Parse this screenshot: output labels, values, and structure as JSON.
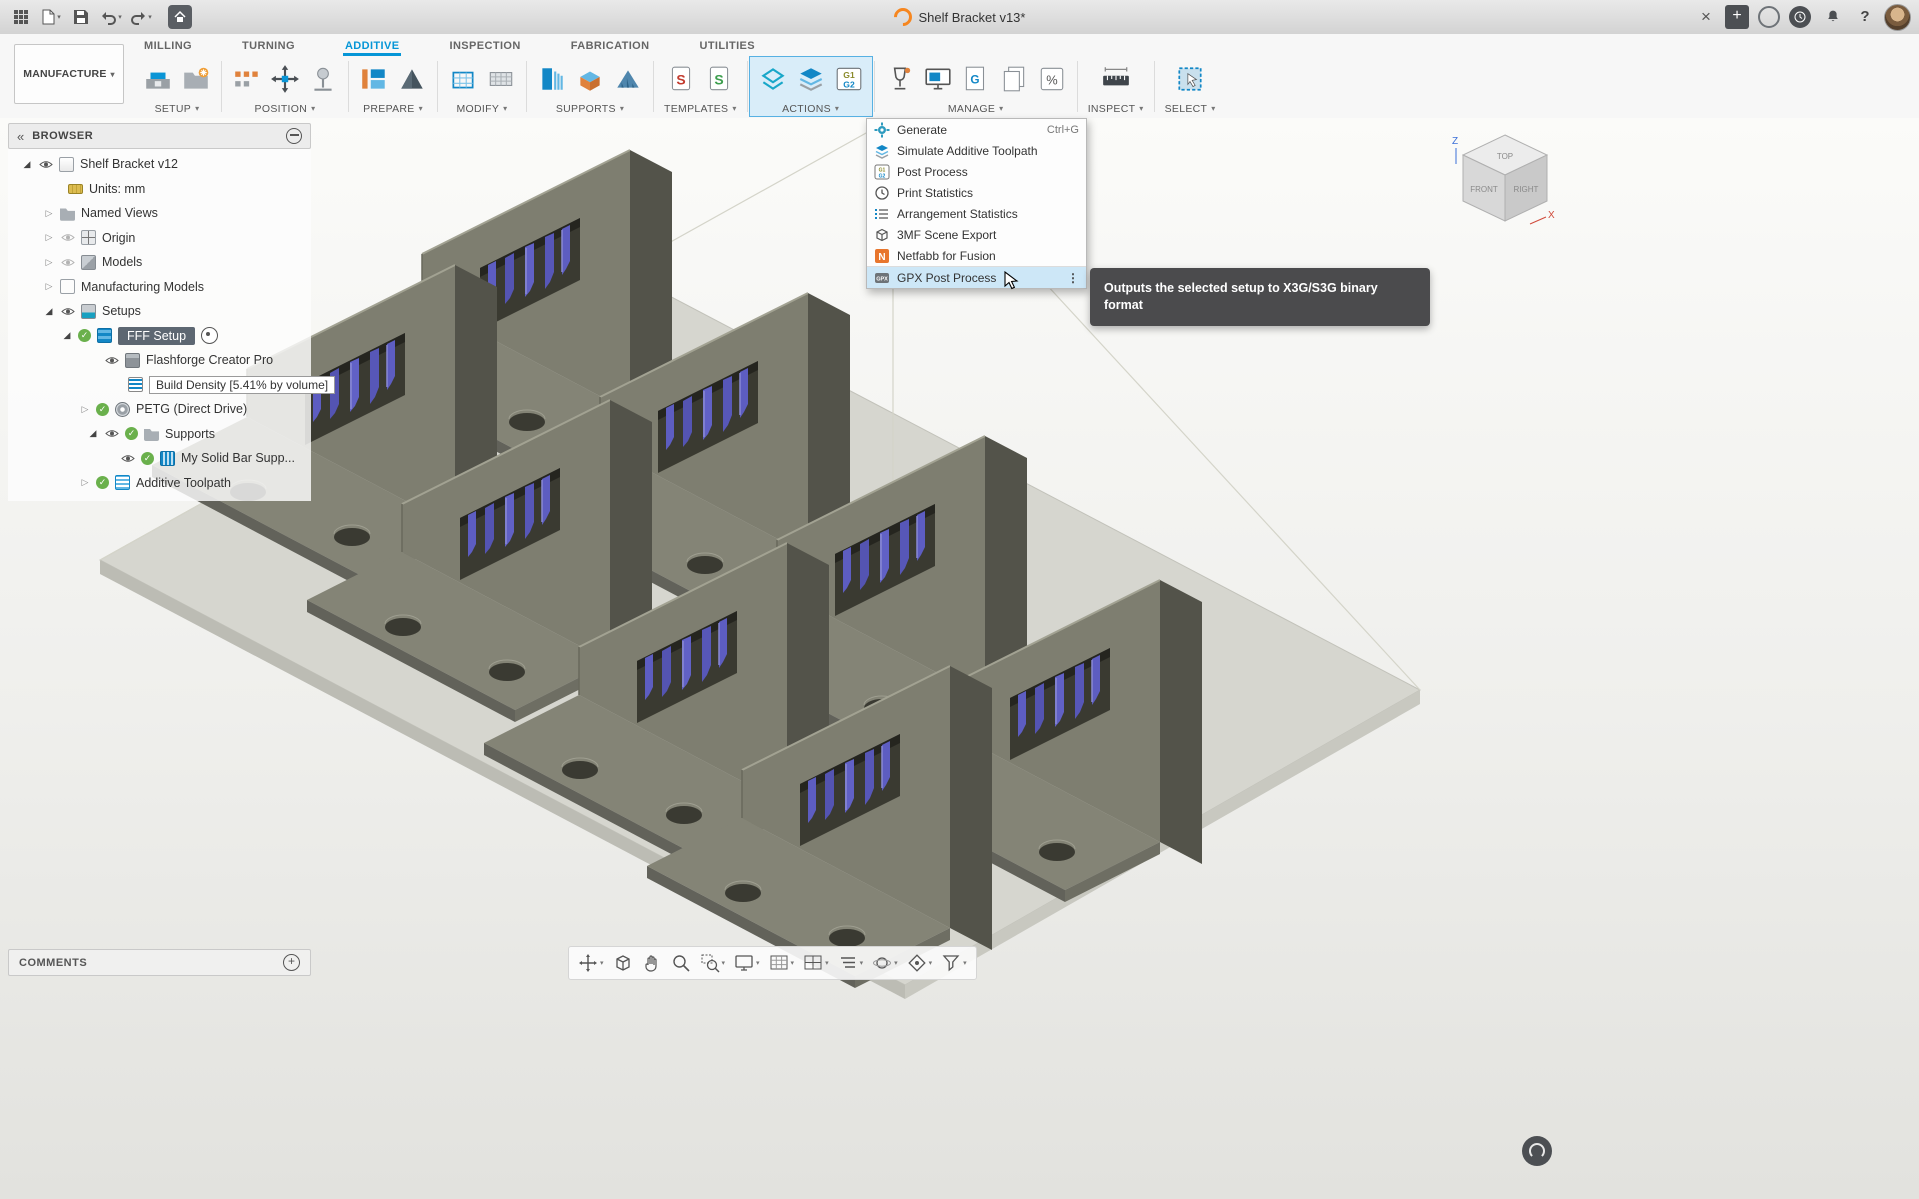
{
  "titlebar": {
    "title": "Shelf Bracket v13*"
  },
  "workspace": {
    "label": "MANUFACTURE"
  },
  "tabs": [
    {
      "label": "MILLING"
    },
    {
      "label": "TURNING"
    },
    {
      "label": "ADDITIVE"
    },
    {
      "label": "INSPECTION"
    },
    {
      "label": "FABRICATION"
    },
    {
      "label": "UTILITIES"
    }
  ],
  "groups": [
    {
      "label": "SETUP"
    },
    {
      "label": "POSITION"
    },
    {
      "label": "PREPARE"
    },
    {
      "label": "MODIFY"
    },
    {
      "label": "SUPPORTS"
    },
    {
      "label": "TEMPLATES"
    },
    {
      "label": "ACTIONS"
    },
    {
      "label": "MANAGE"
    },
    {
      "label": "INSPECT"
    },
    {
      "label": "SELECT"
    }
  ],
  "actions_menu": {
    "items": [
      {
        "label": "Generate",
        "shortcut": "Ctrl+G"
      },
      {
        "label": "Simulate Additive Toolpath"
      },
      {
        "label": "Post Process"
      },
      {
        "label": "Print Statistics"
      },
      {
        "label": "Arrangement Statistics"
      },
      {
        "label": "3MF Scene Export"
      },
      {
        "label": "Netfabb for Fusion"
      },
      {
        "label": "GPX Post Process"
      }
    ]
  },
  "tooltip": {
    "text": "Outputs the selected setup to X3G/S3G binary format"
  },
  "browser": {
    "title": "BROWSER",
    "rows": [
      {
        "label": "Shelf Bracket v12"
      },
      {
        "label": "Units: mm"
      },
      {
        "label": "Named Views"
      },
      {
        "label": "Origin"
      },
      {
        "label": "Models"
      },
      {
        "label": "Manufacturing Models"
      },
      {
        "label": "Setups"
      },
      {
        "label": "FFF Setup"
      },
      {
        "label": "Flashforge Creator Pro"
      },
      {
        "label": "Build Density [5.41% by volume]"
      },
      {
        "label": "PETG (Direct Drive)"
      },
      {
        "label": "Supports"
      },
      {
        "label": "My Solid Bar Supp..."
      },
      {
        "label": "Additive Toolpath"
      }
    ]
  },
  "comments": {
    "label": "COMMENTS"
  },
  "viewcube": {
    "top": "TOP",
    "front": "FRONT",
    "right": "RIGHT",
    "axis_z": "Z",
    "axis_x": "X"
  },
  "icon_text": {
    "g1": "G1",
    "g2": "G2",
    "g": "G",
    "gpx": "GPX",
    "n": "N",
    "pct": "%",
    "s": "S"
  },
  "colors": {
    "accent_blue": "#0696d7",
    "menu_highlight": "#cde7f7",
    "support_blue": "#5a5abe",
    "bracket_olive": "#7e7e70"
  }
}
